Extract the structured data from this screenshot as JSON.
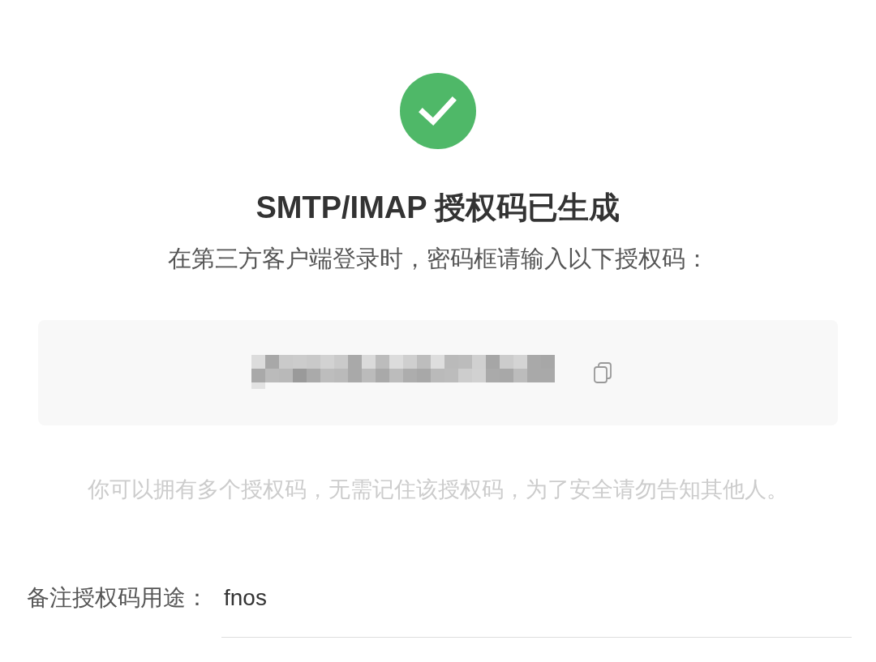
{
  "title": "SMTP/IMAP 授权码已生成",
  "instruction": "在第三方客户端登录时，密码框请输入以下授权码：",
  "hint": "你可以拥有多个授权码，无需记住该授权码，为了安全请勿告知其他人。",
  "purpose_field": {
    "label": "备注授权码用途：",
    "value": "fnos"
  }
}
